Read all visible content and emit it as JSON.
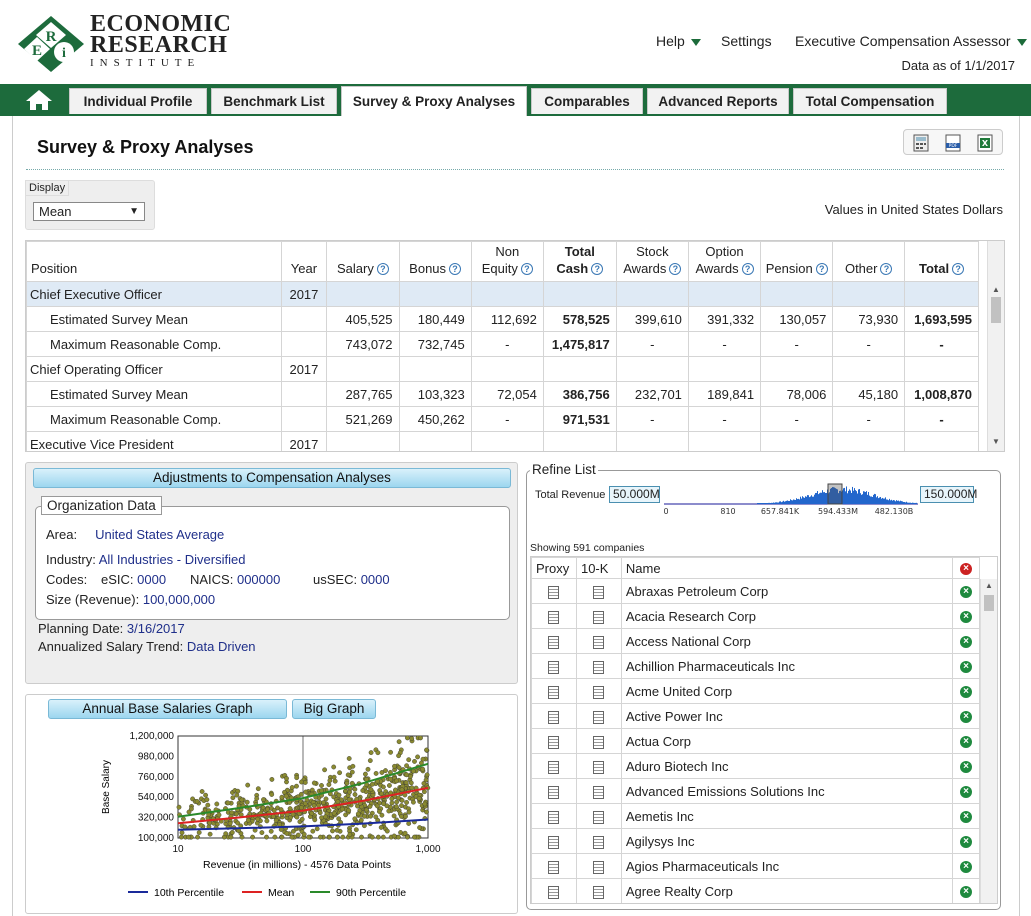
{
  "header": {
    "logo_lines": [
      "ECONOMIC",
      "RESEARCH"
    ],
    "logo_sub": "INSTITUTE",
    "logo_letters": [
      "E",
      "R",
      "i"
    ],
    "nav": [
      {
        "label": "Help",
        "dropdown": true
      },
      {
        "label": "Settings",
        "dropdown": false
      },
      {
        "label": "Executive Compensation Assessor",
        "dropdown": true
      }
    ],
    "data_as_of": "Data as of 1/1/2017"
  },
  "tabs": [
    {
      "label": "Individual Profile",
      "active": false
    },
    {
      "label": "Benchmark List",
      "active": false
    },
    {
      "label": "Survey & Proxy Analyses",
      "active": true
    },
    {
      "label": "Comparables",
      "active": false
    },
    {
      "label": "Advanced Reports",
      "active": false
    },
    {
      "label": "Total Compensation",
      "active": false
    }
  ],
  "page": {
    "title": "Survey & Proxy Analyses",
    "display_label": "Display",
    "display_value": "Mean",
    "values_note": "Values in United States Dollars"
  },
  "grid": {
    "headers": [
      {
        "top": "",
        "bottom": "Position",
        "help": false,
        "bold": false
      },
      {
        "top": "",
        "bottom": "Year",
        "help": false,
        "bold": false
      },
      {
        "top": "",
        "bottom": "Salary",
        "help": true,
        "bold": false
      },
      {
        "top": "",
        "bottom": "Bonus",
        "help": true,
        "bold": false
      },
      {
        "top": "Non",
        "bottom": "Equity",
        "help": true,
        "bold": false
      },
      {
        "top": "Total",
        "bottom": "Cash",
        "help": true,
        "bold": true
      },
      {
        "top": "Stock",
        "bottom": "Awards",
        "help": true,
        "bold": false
      },
      {
        "top": "Option",
        "bottom": "Awards",
        "help": true,
        "bold": false
      },
      {
        "top": "",
        "bottom": "Pension",
        "help": true,
        "bold": false
      },
      {
        "top": "",
        "bottom": "Other",
        "help": true,
        "bold": false
      },
      {
        "top": "",
        "bottom": "Total",
        "help": true,
        "bold": true
      }
    ],
    "rows": [
      {
        "type": "position",
        "name": "Chief Executive Officer",
        "year": "2017",
        "selected": true,
        "cells": [
          "",
          "",
          "",
          "",
          "",
          "",
          "",
          "",
          ""
        ]
      },
      {
        "type": "sub",
        "name": "Estimated Survey Mean",
        "year": "",
        "cells": [
          "405,525",
          "180,449",
          "112,692",
          "578,525",
          "399,610",
          "391,332",
          "130,057",
          "73,930",
          "1,693,595"
        ]
      },
      {
        "type": "sub",
        "name": "Maximum Reasonable Comp.",
        "year": "",
        "cells": [
          "743,072",
          "732,745",
          "-",
          "1,475,817",
          "-",
          "-",
          "-",
          "-",
          "-"
        ]
      },
      {
        "type": "position",
        "name": "Chief Operating Officer",
        "year": "2017",
        "cells": [
          "",
          "",
          "",
          "",
          "",
          "",
          "",
          "",
          ""
        ]
      },
      {
        "type": "sub",
        "name": "Estimated Survey Mean",
        "year": "",
        "cells": [
          "287,765",
          "103,323",
          "72,054",
          "386,756",
          "232,701",
          "189,841",
          "78,006",
          "45,180",
          "1,008,870"
        ]
      },
      {
        "type": "sub",
        "name": "Maximum Reasonable Comp.",
        "year": "",
        "cells": [
          "521,269",
          "450,262",
          "-",
          "971,531",
          "-",
          "-",
          "-",
          "-",
          "-"
        ]
      },
      {
        "type": "position",
        "name": "Executive Vice President",
        "year": "2017",
        "cells": [
          "",
          "",
          "",
          "",
          "",
          "",
          "",
          "",
          ""
        ]
      }
    ]
  },
  "adjustments": {
    "title": "Adjustments to Compensation Analyses",
    "org_title": "Organization Data",
    "area_label": "Area:",
    "area_value": "United States Average",
    "industry_label": "Industry:",
    "industry_value": "All Industries - Diversified",
    "codes_label": "Codes:",
    "esic_label": "eSIC:",
    "esic_value": "0000",
    "naics_label": "NAICS:",
    "naics_value": "000000",
    "ussec_label": "usSEC:",
    "ussec_value": "0000",
    "size_label": "Size (Revenue):",
    "size_value": "100,000,000",
    "planning_label": "Planning Date:",
    "planning_value": "3/16/2017",
    "trend_label": "Annualized Salary Trend:",
    "trend_value": "Data Driven"
  },
  "graph": {
    "button_label": "Annual Base Salaries Graph",
    "big_graph_label": "Big Graph",
    "y_ticks": [
      "1,200,000",
      "980,000",
      "760,000",
      "540,000",
      "320,000",
      "100,000"
    ],
    "x_ticks": [
      "10",
      "100",
      "1,000"
    ],
    "ylabel": "Base Salary",
    "xlabel": "Revenue (in millions) - 4576 Data Points",
    "legend": [
      {
        "name": "10th Percentile",
        "color": "#1a2a9a"
      },
      {
        "name": "Mean",
        "color": "#dd2222"
      },
      {
        "name": "90th Percentile",
        "color": "#2a8a2a"
      }
    ]
  },
  "chart_data": {
    "type": "scatter",
    "xlabel": "Revenue (in millions) - 4576 Data Points",
    "ylabel": "Base Salary",
    "x_scale": "log",
    "xlim": [
      10,
      1000
    ],
    "ylim": [
      100000,
      1200000
    ],
    "grid": true,
    "legend_position": "bottom",
    "series": [
      {
        "name": "10th Percentile",
        "x": [
          10,
          30,
          100,
          300,
          1000
        ],
        "y": [
          190000,
          205000,
          225000,
          255000,
          300000
        ]
      },
      {
        "name": "Mean",
        "x": [
          10,
          30,
          100,
          300,
          1000
        ],
        "y": [
          260000,
          320000,
          395000,
          500000,
          640000
        ]
      },
      {
        "name": "90th Percentile",
        "x": [
          10,
          30,
          100,
          300,
          1000
        ],
        "y": [
          330000,
          420000,
          530000,
          690000,
          900000
        ]
      }
    ]
  },
  "refine": {
    "title": "Refine List",
    "total_revenue_label": "Total Revenue",
    "min_value": "50.000M",
    "max_value": "150.000M",
    "axis_ticks": [
      "0",
      "810",
      "657.841K",
      "594.433M",
      "482.130B"
    ],
    "showing": "Showing 591 companies",
    "col_proxy": "Proxy",
    "col_10k": "10-K",
    "col_name": "Name",
    "companies": [
      "Abraxas Petroleum Corp",
      "Acacia Research Corp",
      "Access National Corp",
      "Achillion Pharmaceuticals Inc",
      "Acme United Corp",
      "Active Power Inc",
      "Actua Corp",
      "Aduro Biotech Inc",
      "Advanced Emissions Solutions Inc",
      "Aemetis Inc",
      "Agilysys Inc",
      "Agios Pharmaceuticals Inc",
      "Agree Realty Corp"
    ]
  }
}
